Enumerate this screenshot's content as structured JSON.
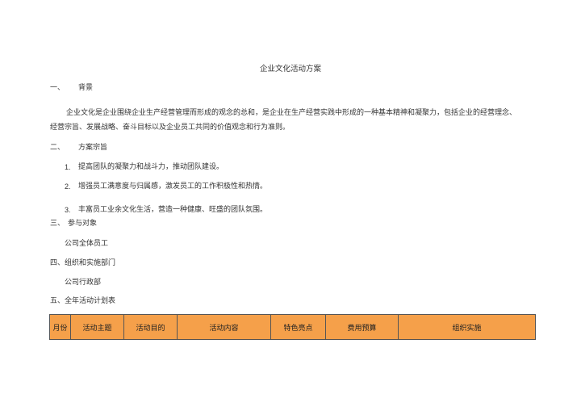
{
  "document": {
    "title": "企业文化活动方案",
    "sections": {
      "s1": {
        "num": "一、",
        "heading": "背景"
      },
      "s1_body": "企业文化是企业围绕企业生产经营管理而形成的观念的总和，是企业在生产经营实践中形成的一种基本精神和凝聚力，包括企业的经营理念、经营宗旨、发展战略、奋斗目标以及企业员工共同的价值观念和行为准则。",
      "s2": {
        "num": "二、",
        "heading": "方案宗旨"
      },
      "s2_items": [
        {
          "num": "1.",
          "text": "提高团队的凝聚力和战斗力，推动团队建设。"
        },
        {
          "num": "2.",
          "text": "增强员工满意度与归属感，激发员工的工作积极性和热情。"
        },
        {
          "num": "3.",
          "text": "丰富员工业余文化生活，营造一种健康、旺盛的团队氛围。"
        }
      ],
      "s3": {
        "num": "三、",
        "heading": "参与对象"
      },
      "s3_body": "公司全体员工",
      "s4": {
        "heading": "四、组织和实施部门"
      },
      "s4_body": "公司行政部",
      "s5": {
        "heading": "五、全年活动计划表"
      }
    },
    "table": {
      "headers": [
        "月份",
        "活动主题",
        "活动目的",
        "活动内容",
        "特色亮点",
        "费用预算",
        "组织实施"
      ]
    }
  },
  "colors": {
    "table_header_bg": "#f5a04a",
    "text": "#333333"
  }
}
